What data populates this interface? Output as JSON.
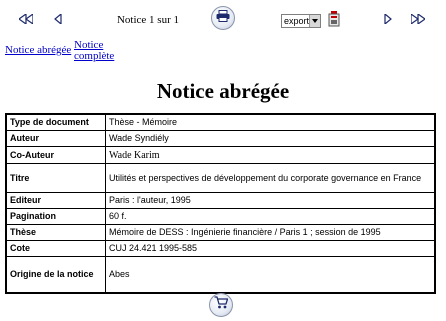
{
  "navigation": {
    "first_icon": "first-record-icon",
    "previous_icon": "previous-record-icon",
    "next_icon": "next-record-icon",
    "last_icon": "last-record-icon",
    "notice_count": "Notice 1 sur 1",
    "print_icon": "print-icon"
  },
  "export": {
    "selected": "export",
    "go_icon": "export-go-icon"
  },
  "views": {
    "short_label": "Notice abrégée",
    "full_label_line1": "Notice",
    "full_label_line2": "complète"
  },
  "page_title": "Notice abrégée",
  "notice": {
    "rows": [
      {
        "label": "Type de document",
        "value": "Thèse - Mémoire"
      },
      {
        "label": "Auteur",
        "value": "Wade Syndiély"
      },
      {
        "label": "Co-Auteur",
        "value": "Wade Karim"
      },
      {
        "label": "Titre",
        "value": "Utilités et perspectives de développement du corporate governance en France"
      },
      {
        "label": "Editeur",
        "value": "Paris : l'auteur, 1995"
      },
      {
        "label": "Pagination",
        "value": "60 f."
      },
      {
        "label": "Thèse",
        "value": "Mémoire de DESS : Ingénierie financière / Paris 1 ; session de 1995"
      },
      {
        "label": "Cote",
        "value": "CUJ 24.421 1995-585"
      },
      {
        "label": "Origine de la notice",
        "value": "Abes"
      }
    ]
  },
  "basket_icon": "basket-icon",
  "colors": {
    "link": "#0000cc",
    "icon": "#1d2a6b",
    "button_border": "#8a94ab"
  }
}
